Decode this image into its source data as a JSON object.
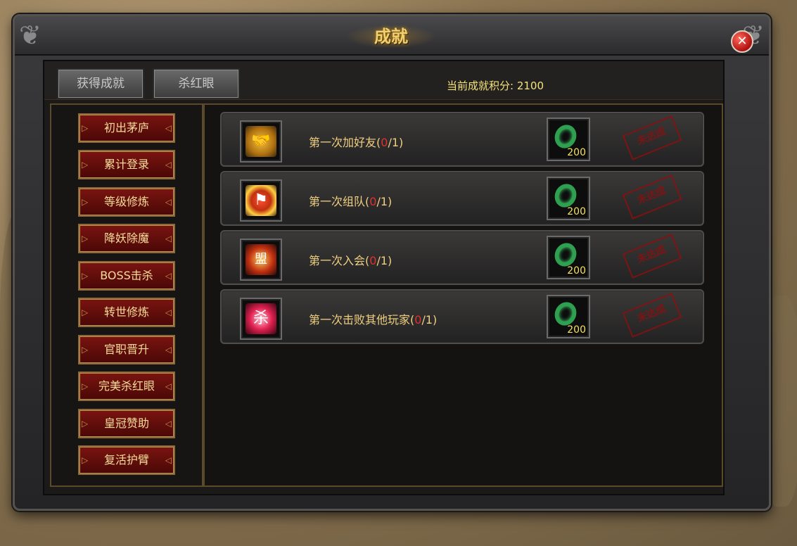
{
  "window": {
    "title": "成就"
  },
  "tabs": [
    {
      "label": "获得成就"
    },
    {
      "label": "杀红眼"
    }
  ],
  "score": {
    "label": "当前成就积分:",
    "value": "2100"
  },
  "categories": [
    {
      "label": "初出茅庐"
    },
    {
      "label": "累计登录"
    },
    {
      "label": "等级修炼"
    },
    {
      "label": "降妖除魔"
    },
    {
      "label": "BOSS击杀"
    },
    {
      "label": "转世修炼"
    },
    {
      "label": "官职晋升"
    },
    {
      "label": "完美杀红眼"
    },
    {
      "label": "皇冠赞助"
    },
    {
      "label": "复活护臂"
    }
  ],
  "achievements": [
    {
      "name": "第一次加好友",
      "current": "0",
      "total": "1",
      "reward_qty": "200",
      "status": "未达成",
      "icon": "handshake-icon"
    },
    {
      "name": "第一次组队",
      "current": "0",
      "total": "1",
      "reward_qty": "200",
      "status": "未达成",
      "icon": "team-flag-icon"
    },
    {
      "name": "第一次入会",
      "current": "0",
      "total": "1",
      "reward_qty": "200",
      "status": "未达成",
      "icon": "guild-emblem-icon"
    },
    {
      "name": "第一次击败其他玩家",
      "current": "0",
      "total": "1",
      "reward_qty": "200",
      "status": "未达成",
      "icon": "kill-seal-icon"
    }
  ],
  "glyphs": {
    "team": "⚑",
    "guild": "盟",
    "kill": "杀",
    "friend": "🤝"
  },
  "colors": {
    "accent": "#f4e27a",
    "label": "#f0d080",
    "progress_current": "#e03030",
    "stamp": "#8a1010"
  }
}
